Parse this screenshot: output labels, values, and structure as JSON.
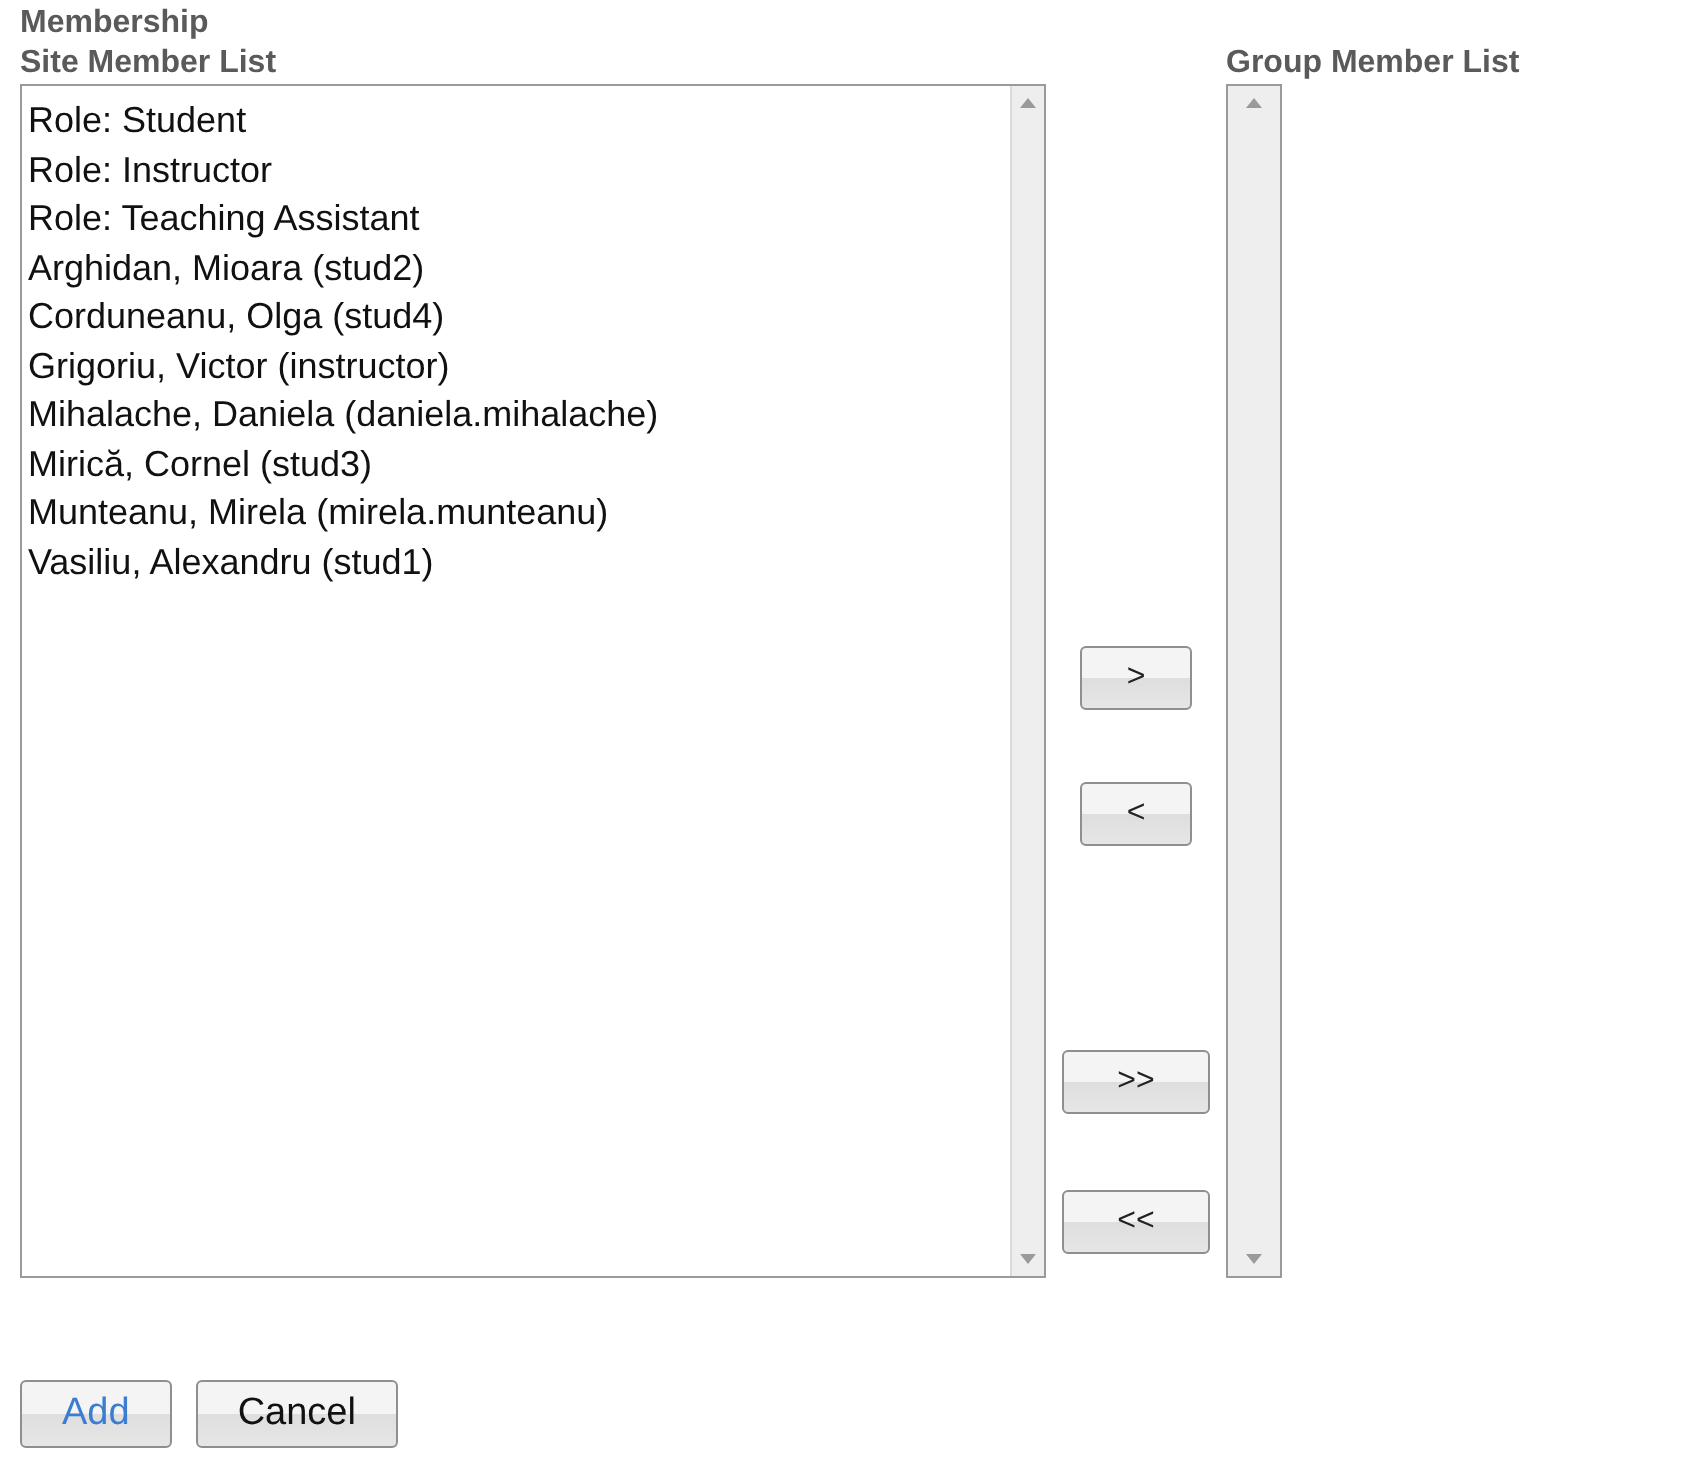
{
  "section_title": "Membership",
  "site_member_list": {
    "label": "Site Member List",
    "items": [
      "Role: Student",
      "Role: Instructor",
      "Role: Teaching Assistant",
      "Arghidan, Mioara (stud2)",
      "Corduneanu, Olga (stud4)",
      "Grigoriu, Victor (instructor)",
      "Mihalache, Daniela (daniela.mihalache)",
      "Mirică, Cornel (stud3)",
      "Munteanu, Mirela (mirela.munteanu)",
      "Vasiliu, Alexandru (stud1)"
    ]
  },
  "transfer_buttons": [
    ">",
    "<",
    ">>",
    "<<"
  ],
  "group_member_list": {
    "label": "Group Member List"
  },
  "buttons": [
    {
      "label": "Add",
      "kind": "primary"
    },
    {
      "label": "Cancel",
      "kind": "default"
    }
  ]
}
